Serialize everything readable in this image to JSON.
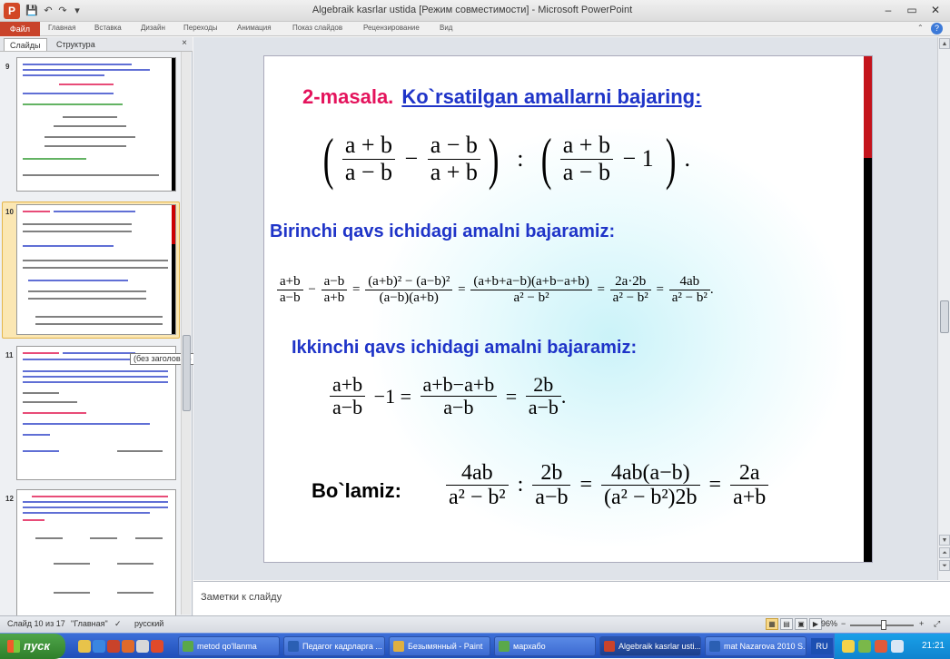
{
  "window": {
    "title": "Algebraik kasrlar ustida [Режим совместимости] - Microsoft PowerPoint",
    "logo_letter": "P",
    "minimize": "–",
    "maximize": "▭",
    "close": "✕"
  },
  "quick_access": {
    "save": "💾",
    "undo": "↶",
    "redo": "↷",
    "customize": "▾"
  },
  "ribbon": {
    "file_tab": "Файл",
    "tabs": [
      "Главная",
      "Вставка",
      "Дизайн",
      "Переходы",
      "Анимация",
      "Показ слайдов",
      "Рецензирование",
      "Вид"
    ],
    "help": "?",
    "collapse": "⌃"
  },
  "left_panel": {
    "tab_slides": "Слайды",
    "tab_outline": "Структура",
    "close": "×",
    "slide_numbers": [
      "9",
      "10",
      "11",
      "12"
    ],
    "tooltip": "(без заголовка)"
  },
  "slide": {
    "title_red": "2-masala.",
    "title_blue": "Ko`rsatilgan amallarni bajaring:",
    "heading1": "Birinchi qavs ichidagi amalni bajaramiz:",
    "heading2": "Ikkinchi qavs ichidagi amalni bajaramiz:",
    "label_divide": "Bo`lamiz:",
    "expr1": {
      "lparen": "(",
      "rparen": ")",
      "f1_num": "a + b",
      "f1_den": "a − b",
      "f2_num": "a − b",
      "f2_den": "a + b",
      "minus": "−",
      "colon": ":",
      "f3_num": "a + b",
      "f3_den": "a − b",
      "minus_one": "− 1",
      "end": "."
    },
    "expr2": {
      "a_num": "a+b",
      "a_den": "a−b",
      "b_num": "a−b",
      "b_den": "a+b",
      "c_num": "(a+b)² − (a−b)²",
      "c_den": "(a−b)(a+b)",
      "d_num": "(a+b+a−b)(a+b−a+b)",
      "d_den": "a² − b²",
      "e_num": "2a·2b",
      "e_den": "a² − b²",
      "f_num": "4ab",
      "f_den": "a² − b²",
      "minus": "−",
      "eq": "=",
      "end": "."
    },
    "expr3": {
      "a_num": "a+b",
      "a_den": "a−b",
      "minus_one": "−1 =",
      "b_num": "a+b−a+b",
      "b_den": "a−b",
      "eq": "=",
      "c_num": "2b",
      "c_den": "a−b",
      "end": "."
    },
    "expr4": {
      "a_num": "4ab",
      "a_den": "a² − b²",
      "colon": ":",
      "b_num": "2b",
      "b_den": "a−b",
      "eq": "=",
      "c_num": "4ab(a−b)",
      "c_den": "(a² − b²)2b",
      "d_num": "2a",
      "d_den": "a+b"
    }
  },
  "notes": {
    "placeholder": "Заметки к слайду"
  },
  "status": {
    "slide_info": "Слайд 10 из 17",
    "theme": "\"Главная\"",
    "language": "русский",
    "zoom": "96%",
    "zoom_minus": "−",
    "zoom_plus": "+"
  },
  "taskbar": {
    "start": "пуск",
    "items": [
      "metod qo'llanma",
      "Педагог кадрларга ...",
      "Безымянный - Paint",
      "мархабо",
      "Algebraik kasrlar usti...",
      "mat Nazarova 2010 S..."
    ],
    "lang": "RU",
    "clock": "21:21"
  },
  "colors": {
    "title_red": "#e4135c",
    "title_blue": "#1f34c8",
    "file_tab": "#c9432a",
    "selected_thumb": "#fbe7b3",
    "taskbar": "#245edb"
  }
}
